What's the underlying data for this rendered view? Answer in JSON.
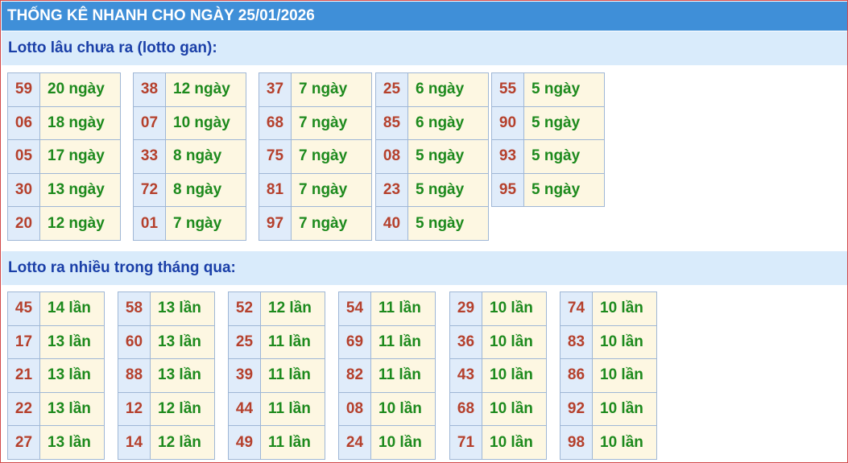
{
  "title": "THỐNG KÊ NHANH CHO NGÀY 25/01/2026",
  "section_gan": {
    "heading": "Lotto lâu chưa ra (lotto gan):",
    "groups": [
      [
        {
          "n": "59",
          "v": "20 ngày"
        },
        {
          "n": "06",
          "v": "18 ngày"
        },
        {
          "n": "05",
          "v": "17 ngày"
        },
        {
          "n": "30",
          "v": "13 ngày"
        },
        {
          "n": "20",
          "v": "12 ngày"
        }
      ],
      [
        {
          "n": "38",
          "v": "12 ngày"
        },
        {
          "n": "07",
          "v": "10 ngày"
        },
        {
          "n": "33",
          "v": "8 ngày"
        },
        {
          "n": "72",
          "v": "8 ngày"
        },
        {
          "n": "01",
          "v": "7 ngày"
        }
      ],
      [
        {
          "n": "37",
          "v": "7 ngày"
        },
        {
          "n": "68",
          "v": "7 ngày"
        },
        {
          "n": "75",
          "v": "7 ngày"
        },
        {
          "n": "81",
          "v": "7 ngày"
        },
        {
          "n": "97",
          "v": "7 ngày"
        }
      ],
      [
        {
          "n": "25",
          "v": "6 ngày"
        },
        {
          "n": "85",
          "v": "6 ngày"
        },
        {
          "n": "08",
          "v": "5 ngày"
        },
        {
          "n": "23",
          "v": "5 ngày"
        },
        {
          "n": "40",
          "v": "5 ngày"
        }
      ],
      [
        {
          "n": "55",
          "v": "5 ngày"
        },
        {
          "n": "90",
          "v": "5 ngày"
        },
        {
          "n": "93",
          "v": "5 ngày"
        },
        {
          "n": "95",
          "v": "5 ngày"
        }
      ]
    ]
  },
  "section_nhieu": {
    "heading": "Lotto ra nhiều trong tháng qua:",
    "groups": [
      [
        {
          "n": "45",
          "v": "14 lần"
        },
        {
          "n": "17",
          "v": "13 lần"
        },
        {
          "n": "21",
          "v": "13 lần"
        },
        {
          "n": "22",
          "v": "13 lần"
        },
        {
          "n": "27",
          "v": "13 lần"
        }
      ],
      [
        {
          "n": "58",
          "v": "13 lần"
        },
        {
          "n": "60",
          "v": "13 lần"
        },
        {
          "n": "88",
          "v": "13 lần"
        },
        {
          "n": "12",
          "v": "12 lần"
        },
        {
          "n": "14",
          "v": "12 lần"
        }
      ],
      [
        {
          "n": "52",
          "v": "12 lần"
        },
        {
          "n": "25",
          "v": "11 lần"
        },
        {
          "n": "39",
          "v": "11 lần"
        },
        {
          "n": "44",
          "v": "11 lần"
        },
        {
          "n": "49",
          "v": "11 lần"
        }
      ],
      [
        {
          "n": "54",
          "v": "11 lần"
        },
        {
          "n": "69",
          "v": "11 lần"
        },
        {
          "n": "82",
          "v": "11 lần"
        },
        {
          "n": "08",
          "v": "10 lần"
        },
        {
          "n": "24",
          "v": "10 lần"
        }
      ],
      [
        {
          "n": "29",
          "v": "10 lần"
        },
        {
          "n": "36",
          "v": "10 lần"
        },
        {
          "n": "43",
          "v": "10 lần"
        },
        {
          "n": "68",
          "v": "10 lần"
        },
        {
          "n": "71",
          "v": "10 lần"
        }
      ],
      [
        {
          "n": "74",
          "v": "10 lần"
        },
        {
          "n": "83",
          "v": "10 lần"
        },
        {
          "n": "86",
          "v": "10 lần"
        },
        {
          "n": "92",
          "v": "10 lần"
        },
        {
          "n": "98",
          "v": "10 lần"
        }
      ]
    ]
  }
}
